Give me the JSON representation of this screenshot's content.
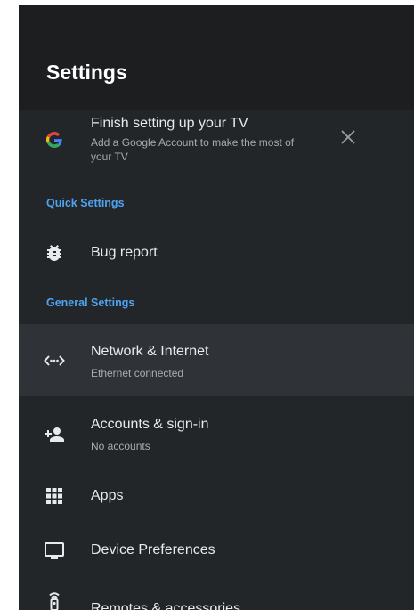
{
  "header": {
    "title": "Settings"
  },
  "promo": {
    "title": "Finish setting up your TV",
    "subtitle_line1": "Add a Google Account to make the most of",
    "subtitle_line2": "your TV"
  },
  "sections": {
    "quick": "Quick Settings",
    "general": "General Settings"
  },
  "quick_items": {
    "bug_report": "Bug report"
  },
  "general_items": {
    "network": {
      "label": "Network & Internet",
      "sub": "Ethernet connected"
    },
    "accounts": {
      "label": "Accounts & sign-in",
      "sub": "No accounts"
    },
    "apps": {
      "label": "Apps"
    },
    "device": {
      "label": "Device Preferences"
    },
    "remotes": {
      "label": "Remotes & accessories"
    }
  },
  "icons": {
    "promo": "google-g-icon",
    "close": "close-icon",
    "bug": "bug-icon",
    "network": "network-arrows-icon",
    "accounts": "add-person-icon",
    "apps": "apps-grid-icon",
    "device": "monitor-icon",
    "remotes": "remote-icon"
  },
  "colors": {
    "panel_bg": "#232629",
    "header_bg": "#1c1e20",
    "selected_row": "#2f3236",
    "section_label": "#4ea3f0",
    "primary_text": "#e9eaeb",
    "secondary_text": "#a7abaf"
  }
}
